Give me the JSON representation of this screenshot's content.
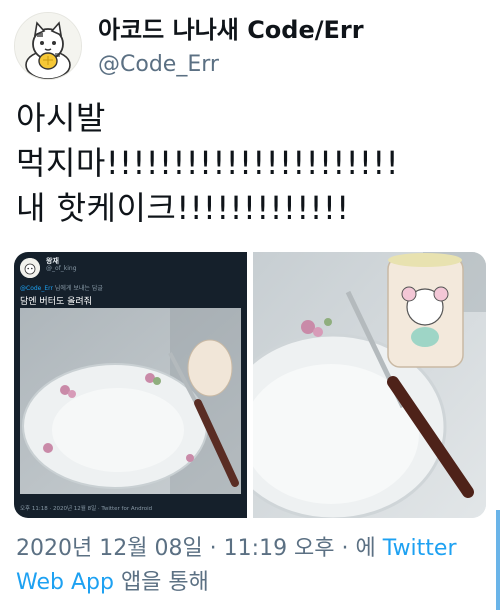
{
  "tweet": {
    "display_name": "아코드 나나새 Code/Err",
    "handle": "@Code_Err",
    "text": "아시발\n먹지마!!!!!!!!!!!!!!!!!!!!!!\n내 핫케이크!!!!!!!!!!!!!",
    "timestamp": "2020년 12월 08일 · 11:19 오후 · 에",
    "source": "Twitter Web App",
    "source_suffix": "앱을 통해"
  },
  "embedded_tweet": {
    "name": "왕재",
    "handle": "@_of_king",
    "reply_mention": "@Code_Err",
    "reply_suffix": "님에게 보내는 답글",
    "text": "담엔 버터도 올려줘",
    "footer": "오후 11:18 · 2020년 12월 8일 · Twitter for Android"
  },
  "colors": {
    "link": "#1da1f2",
    "secondary_text": "#5b7083",
    "primary_text": "#0f1419",
    "embedded_bg": "#15202b"
  },
  "icons": [
    "avatar-cat-illustration",
    "embed-avatar-cat"
  ]
}
